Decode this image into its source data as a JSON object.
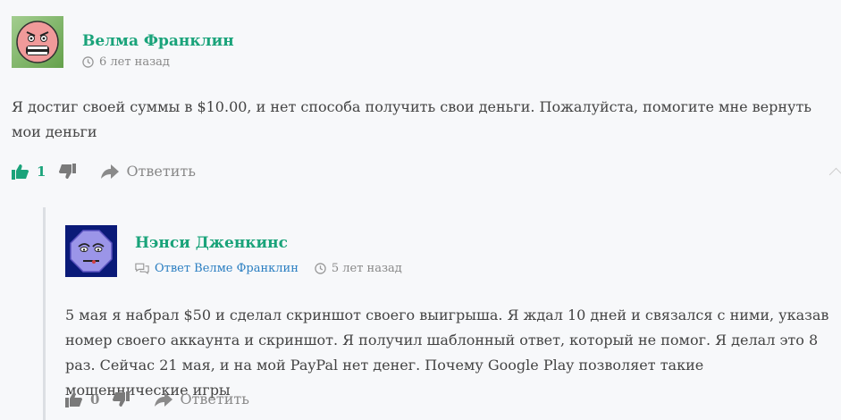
{
  "comment": {
    "author": "Велма Франклин",
    "time": "6 лет назад",
    "text": "Я достиг своей суммы в $10.00, и нет способа получить свои деньги. Пожалуйста, помогите мне вернуть мои деньги",
    "likes": "1",
    "reply_label": "Ответить"
  },
  "reply": {
    "author": "Нэнси Дженкинс",
    "reply_to": "Ответ Велме Франклин",
    "time": "5 лет назад",
    "text": "5 мая я набрал $50 и сделал скриншот своего выигрыша. Я ждал 10 дней и связался с ними, указав номер своего аккаунта и скриншот. Я получил шаблонный ответ, который не помог. Я делал это 8 раз. Сейчас 21 мая, и на мой PayPal нет денег. Почему Google Play позволяет такие мошеннические игры",
    "likes": "0",
    "reply_label": "Ответить"
  },
  "icons": {
    "avatar_1": "angry-face-avatar",
    "avatar_2": "octagon-face-avatar",
    "clock": "clock-icon",
    "thumbs_up": "thumbs-up-icon",
    "thumbs_down": "thumbs-down-icon",
    "reply": "reply-arrow-icon",
    "chat": "chat-bubbles-icon"
  },
  "colors": {
    "author": "#1aa37a",
    "link": "#2a7ec1",
    "text": "#444444",
    "muted": "#888888"
  }
}
